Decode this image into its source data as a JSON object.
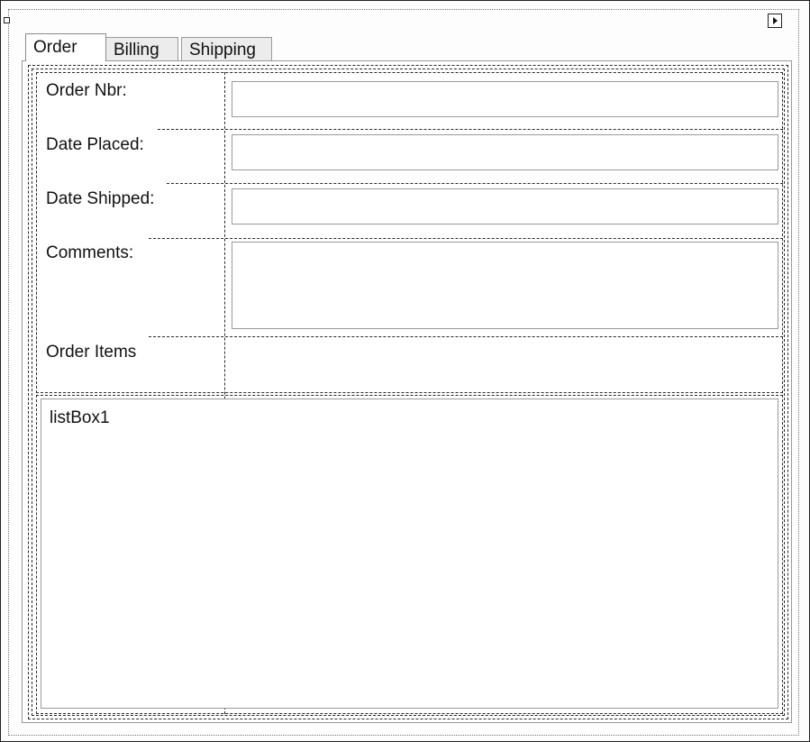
{
  "tabs": [
    {
      "label": "Order",
      "active": true
    },
    {
      "label": "Billing",
      "active": false
    },
    {
      "label": "Shipping",
      "active": false
    }
  ],
  "form": {
    "order_nbr_label": "Order Nbr:",
    "date_placed_label": "Date Placed:",
    "date_shipped_label": "Date Shipped:",
    "comments_label": "Comments:",
    "order_items_label": "Order Items",
    "order_nbr_value": "",
    "date_placed_value": "",
    "date_shipped_value": "",
    "comments_value": ""
  },
  "listbox": {
    "name": "listBox1"
  }
}
